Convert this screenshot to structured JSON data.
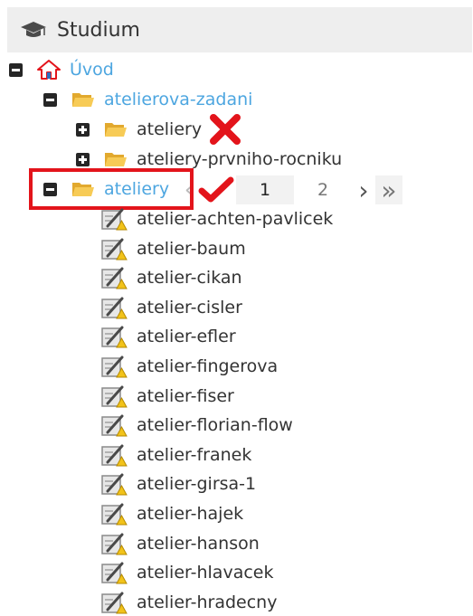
{
  "header": {
    "title": "Studium",
    "icon": "graduation-cap-icon"
  },
  "tree": {
    "root": {
      "label": "Úvod",
      "icon": "home-icon",
      "expanded": true
    },
    "l1": {
      "label": "atelierova-zadani",
      "expanded": true
    },
    "l2a": {
      "label": "ateliery",
      "expanded": false,
      "mark": "red-x-icon"
    },
    "l2b": {
      "label": "ateliery-prvniho-rocniku",
      "expanded": false
    },
    "l1b": {
      "label": "ateliery",
      "expanded": true,
      "mark": "red-check-icon"
    },
    "items": [
      "atelier-achten-pavlicek",
      "atelier-baum",
      "atelier-cikan",
      "atelier-cisler",
      "atelier-efler",
      "atelier-fingerova",
      "atelier-fiser",
      "atelier-florian-flow",
      "atelier-franek",
      "atelier-girsa-1",
      "atelier-hajek",
      "atelier-hanson",
      "atelier-hlavacek",
      "atelier-hradecny"
    ]
  },
  "pager": {
    "prev": "‹",
    "page1": "1",
    "page2": "2",
    "next": "›",
    "last": "»",
    "current": 1
  },
  "colors": {
    "link": "#4da6e0",
    "highlight": "#e3141b",
    "folder": "#f5c342",
    "header_bg": "#eeeeee"
  }
}
